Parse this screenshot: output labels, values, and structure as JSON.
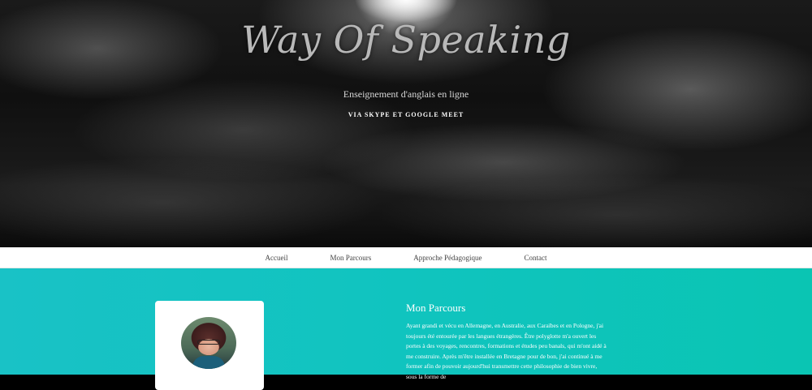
{
  "hero": {
    "title": "Way Of Speaking",
    "tagline": "Enseignement d'anglais en ligne",
    "subtagline": "VIA SKYPE ET GOOGLE MEET"
  },
  "nav": {
    "items": [
      {
        "label": "Accueil"
      },
      {
        "label": "Mon Parcours"
      },
      {
        "label": "Approche Pédagogique"
      },
      {
        "label": "Contact"
      }
    ]
  },
  "section": {
    "title": "Mon Parcours",
    "body": "Ayant grandi et vécu en Allemagne, en Australie, aux Caraïbes et en Pologne, j'ai toujours été entourée par les langues étrangères. Être polyglotte m'a ouvert les portes à des voyages, rencontres, formations et études peu banals, qui m'ont aidé à me construire. Après m'être installée en Bretagne pour de bon, j'ai continué à me former afin de pouvoir aujourd'hui transmettre cette philosophie de bien vivre, sous la forme de"
  },
  "colors": {
    "accent_teal": "#10c4bf",
    "nav_bg": "#ffffff",
    "hero_bg": "#101010"
  }
}
